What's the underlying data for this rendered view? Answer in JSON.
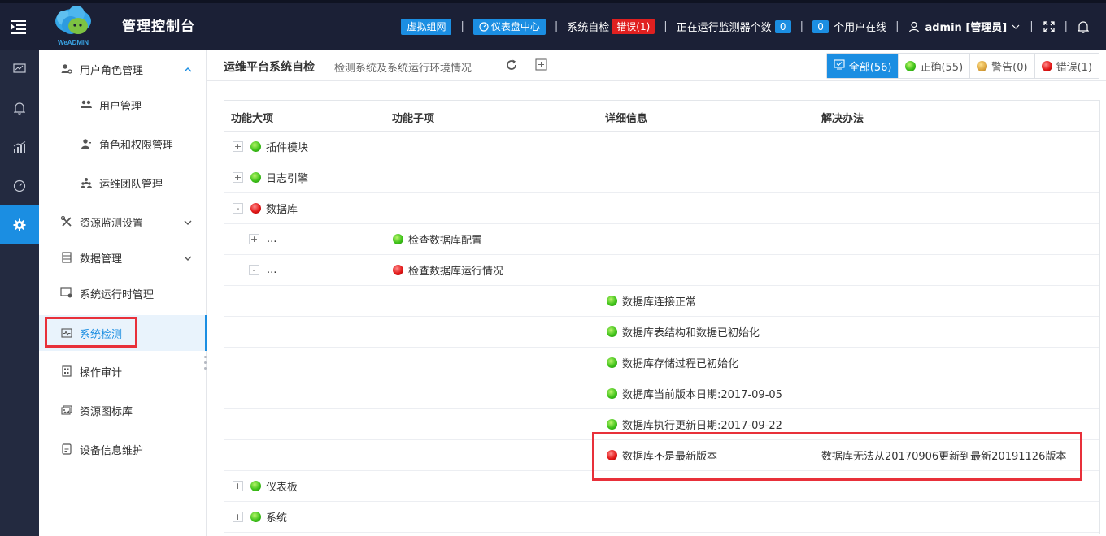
{
  "header": {
    "title": "管理控制台",
    "logo_text": "WeADMIN",
    "virtual_net_label": "虚拟组网",
    "dashboard_label": "仪表盘中心",
    "self_check_label": "系统自检",
    "self_check_error": "错误(1)",
    "monitor_label": "正在运行监测器个数",
    "monitor_count": "0",
    "online_count": "0",
    "online_label": "个用户在线",
    "user_label": "admin [管理员]"
  },
  "sidebar": {
    "items": [
      {
        "label": "用户角色管理"
      },
      {
        "label": "用户管理"
      },
      {
        "label": "角色和权限管理"
      },
      {
        "label": "运维团队管理"
      },
      {
        "label": "资源监测设置"
      },
      {
        "label": "数据管理"
      },
      {
        "label": "系统运行时管理"
      },
      {
        "label": "系统检测"
      },
      {
        "label": "操作审计"
      },
      {
        "label": "资源图标库"
      },
      {
        "label": "设备信息维护"
      }
    ]
  },
  "page": {
    "title": "运维平台系统自检",
    "subtitle": "检测系统及系统运行环境情况",
    "filters": [
      {
        "label": "全部(56)",
        "status": "all"
      },
      {
        "label": "正确(55)",
        "status": "ok"
      },
      {
        "label": "警告(0)",
        "status": "warn"
      },
      {
        "label": "错误(1)",
        "status": "error"
      }
    ]
  },
  "table": {
    "headers": [
      "功能大项",
      "功能子项",
      "详细信息",
      "解决办法"
    ],
    "rows": [
      {
        "expander": "+",
        "status": "green",
        "major": "插件模块"
      },
      {
        "expander": "+",
        "status": "green",
        "major": "日志引擎"
      },
      {
        "expander": "-",
        "status": "red",
        "major": "数据库"
      },
      {
        "expander": "+",
        "major": "...",
        "sub_status": "green",
        "sub": "检查数据库配置"
      },
      {
        "expander": "-",
        "major": "...",
        "sub_status": "red",
        "sub": "检查数据库运行情况"
      },
      {
        "detail_status": "green",
        "detail": "数据库连接正常"
      },
      {
        "detail_status": "green",
        "detail": "数据库表结构和数据已初始化"
      },
      {
        "detail_status": "green",
        "detail": "数据库存储过程已初始化"
      },
      {
        "detail_status": "green",
        "detail": "数据库当前版本日期:2017-09-05"
      },
      {
        "detail_status": "green",
        "detail": "数据库执行更新日期:2017-09-22"
      },
      {
        "detail_status": "red",
        "detail": "数据库不是最新版本",
        "solution": "数据库无法从20170906更新到最新20191126版本"
      },
      {
        "expander": "+",
        "status": "green",
        "major": "仪表板"
      },
      {
        "expander": "+",
        "status": "green",
        "major": "系统"
      }
    ]
  },
  "colors": {
    "accent": "#1b8ee2",
    "topbar": "#1b2036",
    "rail": "#232a40",
    "error": "#e02020",
    "highlight_box": "#e8303a"
  }
}
